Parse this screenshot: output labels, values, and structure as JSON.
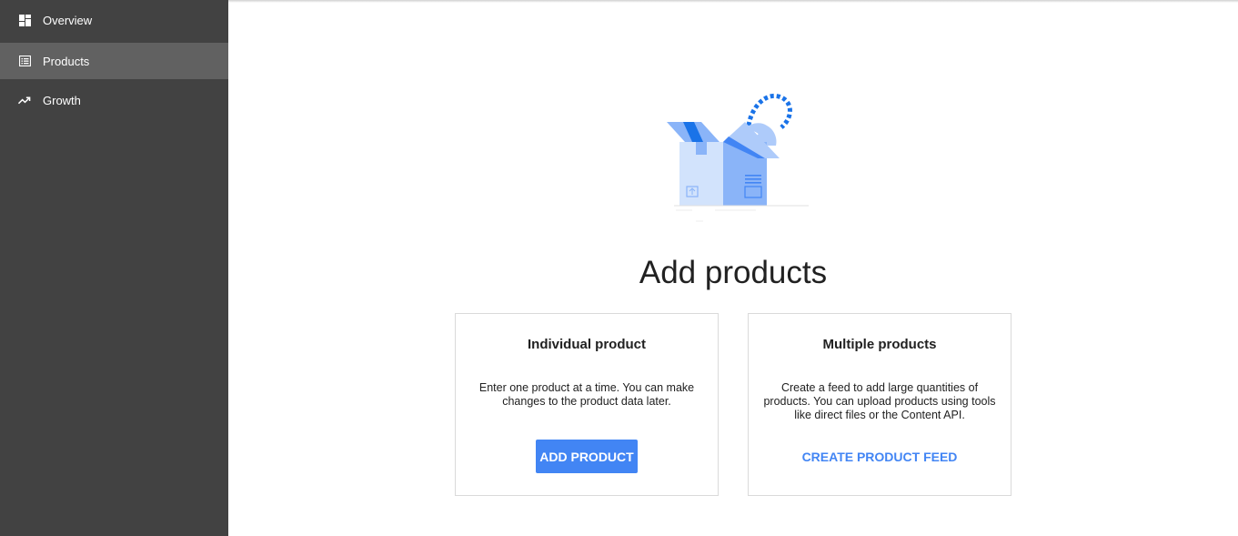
{
  "sidebar": {
    "items": [
      {
        "label": "Overview",
        "icon": "dashboard-icon",
        "active": false
      },
      {
        "label": "Products",
        "icon": "list-icon",
        "active": true
      },
      {
        "label": "Growth",
        "icon": "trending-up-icon",
        "active": false
      }
    ]
  },
  "main": {
    "title": "Add products",
    "hero_icon": "open-box-illustration",
    "cards": [
      {
        "title": "Individual product",
        "description": "Enter one product at a time. You can make changes to the product data later.",
        "action_label": "ADD PRODUCT"
      },
      {
        "title": "Multiple products",
        "description": "Create a feed to add large quantities of products. You can upload products using tools like direct files or the Content API.",
        "action_label": "CREATE PRODUCT FEED"
      }
    ]
  },
  "colors": {
    "sidebar_bg": "#424242",
    "sidebar_active": "#616161",
    "accent": "#4285f4"
  }
}
